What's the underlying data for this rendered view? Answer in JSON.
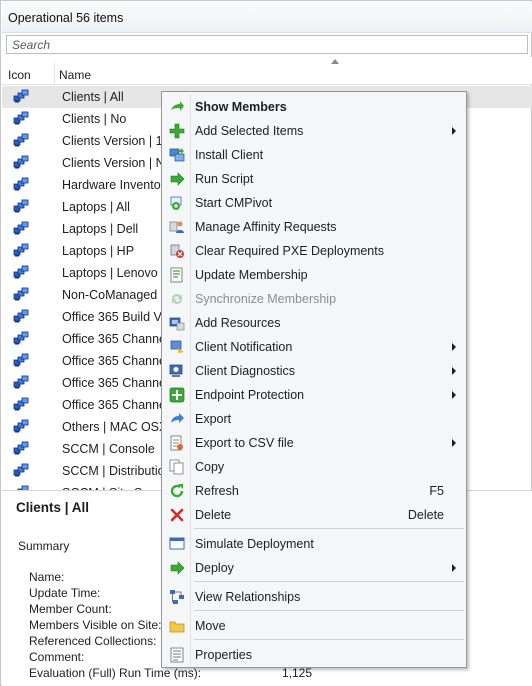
{
  "header": {
    "title": "Operational 56 items"
  },
  "search": {
    "placeholder": "Search"
  },
  "columns": {
    "icon": "Icon",
    "name": "Name"
  },
  "rows": [
    {
      "name": "Clients | All",
      "selected": true
    },
    {
      "name": "Clients | No"
    },
    {
      "name": "Clients Version | 19"
    },
    {
      "name": "Clients Version | No"
    },
    {
      "name": "Hardware Inventory"
    },
    {
      "name": "Laptops | All"
    },
    {
      "name": "Laptops | Dell"
    },
    {
      "name": "Laptops | HP"
    },
    {
      "name": "Laptops | Lenovo"
    },
    {
      "name": "Non-CoManaged c"
    },
    {
      "name": "Office 365 Build Ve"
    },
    {
      "name": "Office 365 Channel"
    },
    {
      "name": "Office 365 Channel"
    },
    {
      "name": "Office 365 Channel"
    },
    {
      "name": "Office 365 Channel"
    },
    {
      "name": "Others | MAC OSX"
    },
    {
      "name": "SCCM | Console"
    },
    {
      "name": "SCCM | Distribution"
    },
    {
      "name": "SCCM | Site S"
    }
  ],
  "details": {
    "title": "Clients | All",
    "summary_label": "Summary",
    "fields": [
      {
        "label": "Name:",
        "value": ""
      },
      {
        "label": "Update Time:",
        "value": ""
      },
      {
        "label": "Member Count:",
        "value": ""
      },
      {
        "label": "Members Visible on Site:",
        "value": ""
      },
      {
        "label": "Referenced Collections:",
        "value": ""
      },
      {
        "label": "Comment:",
        "value": ""
      },
      {
        "label": "Evaluation (Full) Run Time (ms):",
        "value": "1,125"
      }
    ]
  },
  "context_menu": {
    "items": [
      {
        "label": "Show Members",
        "icon": "show-members-icon",
        "bold": true
      },
      {
        "label": "Add Selected Items",
        "icon": "add-icon",
        "submenu": true
      },
      {
        "label": "Install Client",
        "icon": "install-client-icon"
      },
      {
        "label": "Run Script",
        "icon": "run-script-icon"
      },
      {
        "label": "Start CMPivot",
        "icon": "cmpivot-icon"
      },
      {
        "label": "Manage Affinity Requests",
        "icon": "affinity-icon"
      },
      {
        "label": "Clear Required PXE Deployments",
        "icon": "pxe-icon"
      },
      {
        "label": "Update Membership",
        "icon": "update-membership-icon"
      },
      {
        "label": "Synchronize Membership",
        "icon": "sync-icon",
        "disabled": true
      },
      {
        "label": "Add Resources",
        "icon": "add-resources-icon"
      },
      {
        "label": "Client Notification",
        "icon": "notification-icon",
        "submenu": true
      },
      {
        "label": "Client Diagnostics",
        "icon": "diagnostics-icon",
        "submenu": true
      },
      {
        "label": "Endpoint Protection",
        "icon": "endpoint-protection-icon",
        "submenu": true
      },
      {
        "label": "Export",
        "icon": "export-icon"
      },
      {
        "label": "Export to CSV file",
        "icon": "csv-icon",
        "submenu": true
      },
      {
        "label": "Copy",
        "icon": "copy-icon"
      },
      {
        "label": "Refresh",
        "icon": "refresh-icon",
        "shortcut": "F5"
      },
      {
        "label": "Delete",
        "icon": "delete-icon",
        "shortcut": "Delete"
      },
      {
        "label": "Simulate Deployment",
        "icon": "simulate-icon"
      },
      {
        "label": "Deploy",
        "icon": "deploy-icon",
        "submenu": true
      },
      {
        "label": "View Relationships",
        "icon": "relationships-icon"
      },
      {
        "label": "Move",
        "icon": "move-icon"
      },
      {
        "label": "Properties",
        "icon": "properties-icon"
      }
    ]
  },
  "colors": {
    "accent_green": "#3aa935",
    "accent_blue": "#2a6fcf",
    "selection_gray": "#e6e6e6",
    "delete_red": "#d12b2b"
  }
}
